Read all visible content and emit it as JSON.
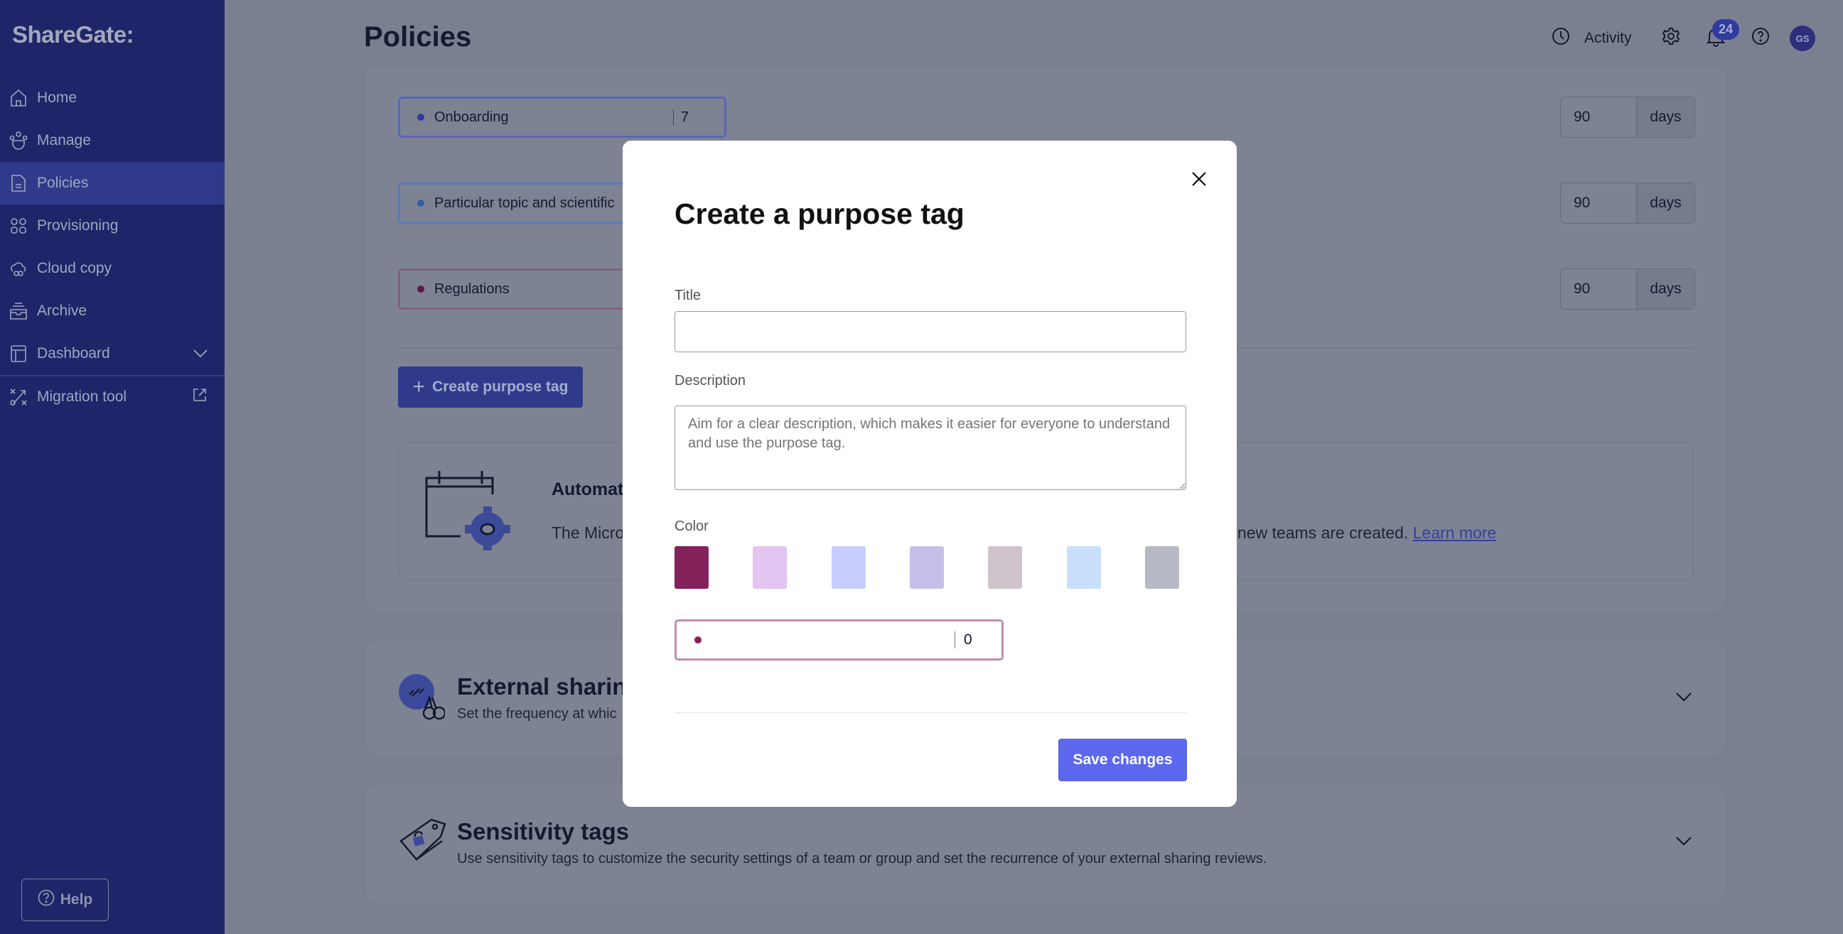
{
  "app": {
    "logo": "ShareGate:"
  },
  "sidebar": {
    "items": [
      {
        "label": "Home",
        "icon": "home-icon"
      },
      {
        "label": "Manage",
        "icon": "manage-icon"
      },
      {
        "label": "Policies",
        "icon": "document-icon",
        "active": true
      },
      {
        "label": "Provisioning",
        "icon": "provisioning-icon"
      },
      {
        "label": "Cloud copy",
        "icon": "cloud-icon"
      },
      {
        "label": "Archive",
        "icon": "archive-icon"
      },
      {
        "label": "Dashboard",
        "icon": "dashboard-icon"
      },
      {
        "label": "Migration tool",
        "icon": "migration-icon"
      }
    ],
    "help": "Help"
  },
  "header": {
    "title": "Policies",
    "activity": "Activity",
    "notifications": "24",
    "avatar": "GS"
  },
  "tags": [
    {
      "name": "Onboarding",
      "count": "7",
      "days": "90",
      "unit": "days",
      "color": "#2f3ba0"
    },
    {
      "name": "Particular topic and scientific",
      "days": "90",
      "unit": "days",
      "color": "#2f5fa8"
    },
    {
      "name": "Regulations",
      "days": "90",
      "unit": "days",
      "color": "#5a1a4a"
    }
  ],
  "create_button": "Create purpose tag",
  "automation": {
    "title": "Automat",
    "text_start": "The Micro",
    "text_end": "new teams are created.",
    "link": "Learn more"
  },
  "external": {
    "title": "External sharing",
    "subtitle": "Set the frequency at whic"
  },
  "sensitivity": {
    "title": "Sensitivity tags",
    "subtitle": "Use sensitivity tags to customize the security settings of a team or group and set the recurrence of your external sharing reviews."
  },
  "modal": {
    "title": "Create a purpose tag",
    "title_label": "Title",
    "title_value": "",
    "description_label": "Description",
    "description_placeholder": "Aim for a clear description, which makes it easier for everyone to understand and use the purpose tag.",
    "color_label": "Color",
    "colors": [
      "#84215a",
      "#e4c4f0",
      "#c7cdfc",
      "#c6bfea",
      "#cfc4cc",
      "#cadffc",
      "#b7b9c4"
    ],
    "selected_color": "#84215a",
    "preview_count": "0",
    "save": "Save changes"
  }
}
